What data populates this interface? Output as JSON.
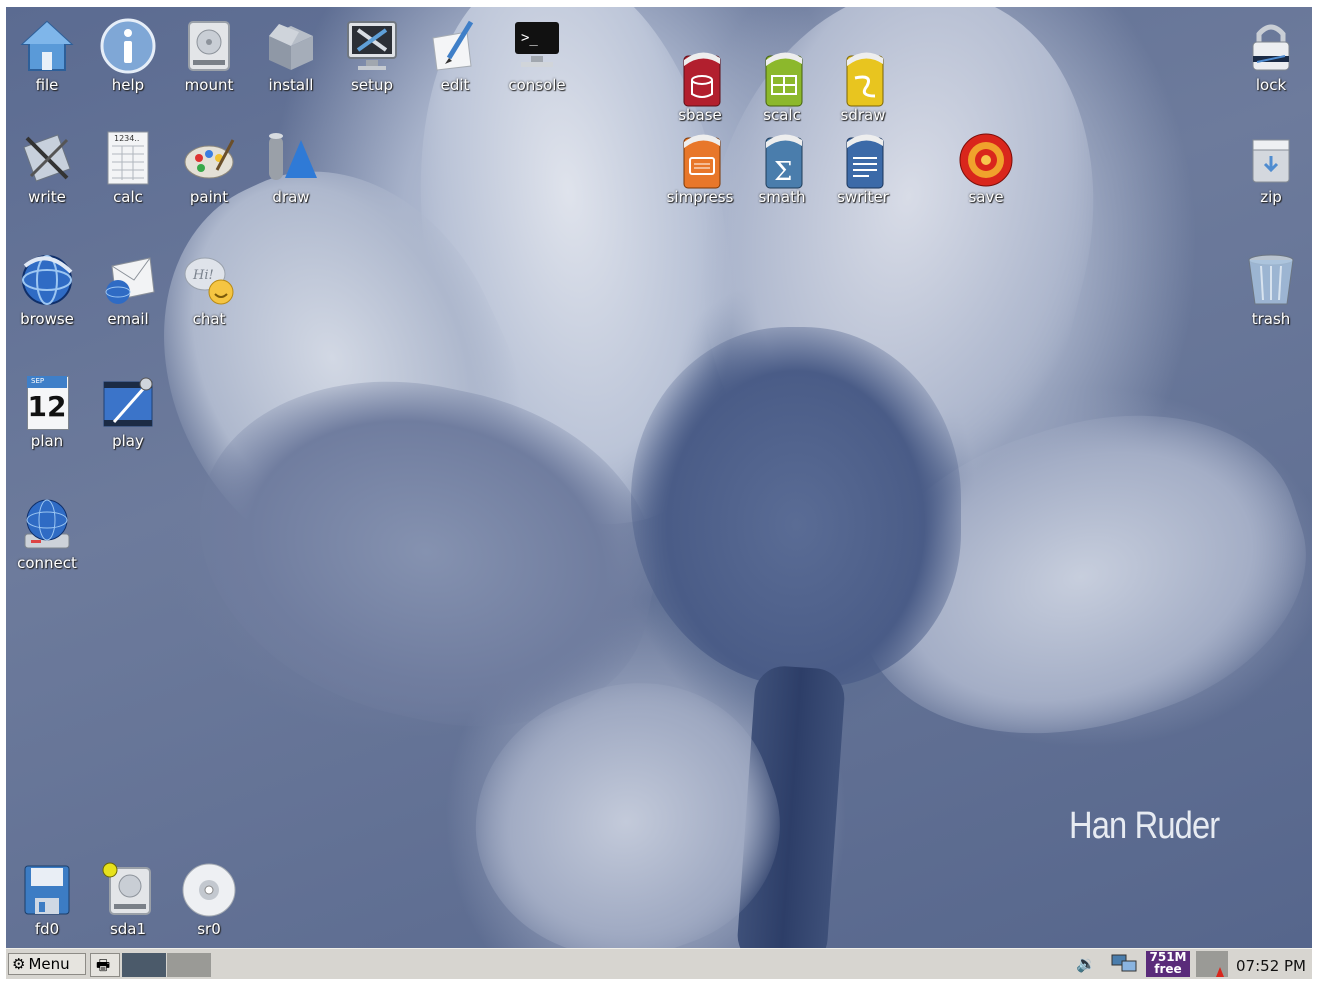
{
  "desktop": {
    "watermark": "Han Ruder",
    "icons_left": [
      {
        "label": "file",
        "icon": "home-folder-icon"
      },
      {
        "label": "help",
        "icon": "info-icon"
      },
      {
        "label": "mount",
        "icon": "drive-icon"
      },
      {
        "label": "install",
        "icon": "package-box-icon"
      },
      {
        "label": "setup",
        "icon": "tools-monitor-icon"
      },
      {
        "label": "edit",
        "icon": "pencil-paper-icon"
      },
      {
        "label": "console",
        "icon": "terminal-icon"
      },
      {
        "label": "write",
        "icon": "writer-tools-icon"
      },
      {
        "label": "calc",
        "icon": "calculator-sheet-icon"
      },
      {
        "label": "paint",
        "icon": "palette-icon"
      },
      {
        "label": "draw",
        "icon": "shapes-icon"
      },
      {
        "label": "browse",
        "icon": "globe-browser-icon"
      },
      {
        "label": "email",
        "icon": "envelope-globe-icon"
      },
      {
        "label": "chat",
        "icon": "chat-bubble-icon"
      },
      {
        "label": "plan",
        "icon": "calendar-icon"
      },
      {
        "label": "play",
        "icon": "media-player-icon"
      },
      {
        "label": "connect",
        "icon": "network-globe-icon"
      }
    ],
    "calendar_day": "12",
    "calendar_month": "SEP",
    "office_icons": [
      {
        "label": "sbase",
        "icon": "database-icon",
        "color": "#b21f2e"
      },
      {
        "label": "scalc",
        "icon": "spreadsheet-icon",
        "color": "#8cb82c"
      },
      {
        "label": "sdraw",
        "icon": "draw-doc-icon",
        "color": "#e8c51f"
      },
      {
        "label": "simpress",
        "icon": "presentation-icon",
        "color": "#e8772a"
      },
      {
        "label": "smath",
        "icon": "math-sigma-icon",
        "color": "#4a7dac"
      },
      {
        "label": "swriter",
        "icon": "text-document-icon",
        "color": "#3c6aa8"
      },
      {
        "label": "save",
        "icon": "target-icon",
        "color": "#d9261c"
      }
    ],
    "icons_right": [
      {
        "label": "lock",
        "icon": "padlock-icon"
      },
      {
        "label": "zip",
        "icon": "archive-icon"
      },
      {
        "label": "trash",
        "icon": "trash-can-icon"
      }
    ],
    "drives": [
      {
        "label": "fd0",
        "icon": "floppy-icon"
      },
      {
        "label": "sda1",
        "icon": "hard-drive-icon"
      },
      {
        "label": "sr0",
        "icon": "cd-icon"
      }
    ]
  },
  "taskbar": {
    "menu_label": "Menu",
    "memory_top": "751M",
    "memory_bottom": "free",
    "clock": "07:52 PM"
  }
}
